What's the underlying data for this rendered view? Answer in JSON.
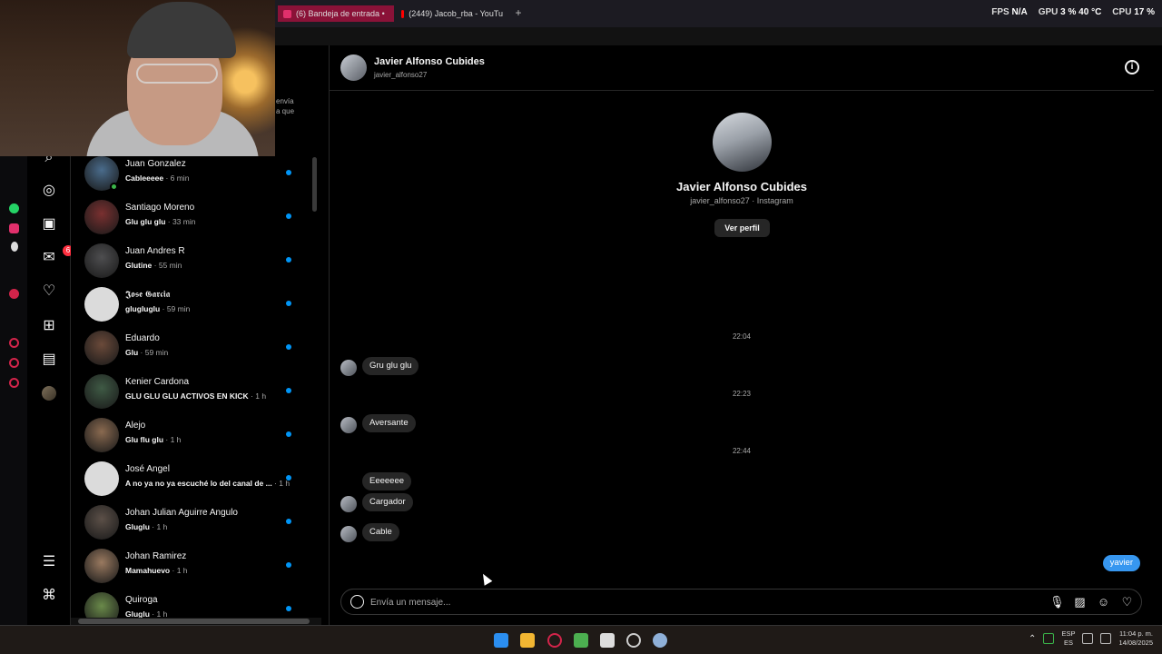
{
  "browser": {
    "tabs": [
      {
        "label": "(6) Bandeja de entrada •",
        "color": "#d2244a"
      },
      {
        "label": "(2449) Jacob_rba - YouTu",
        "color": "#ff0000"
      }
    ],
    "address_fragment": "392",
    "stats": {
      "fps_label": "FPS",
      "fps_value": "N/A",
      "gpu_label": "GPU",
      "gpu_value": "3 %",
      "gpu_temp": "40 °C",
      "cpu_label": "CPU",
      "cpu_value": "17 %"
    }
  },
  "rail": {
    "notification_badge": "6"
  },
  "list": {
    "top_snippet": [
      "envía",
      "a que"
    ],
    "conversations": [
      {
        "name": "Juan Gonzalez",
        "message": "Cableeeee",
        "time": "· 6 min",
        "online": true,
        "color": "#4a6c8c"
      },
      {
        "name": "Santiago Moreno",
        "message": "Glu glu glu",
        "time": "· 33 min",
        "online": false,
        "color": "#7a3030"
      },
      {
        "name": "Juan Andres R",
        "message": "Glutine",
        "time": "· 55 min",
        "online": false,
        "color": "#4e4e50"
      },
      {
        "name": "𝕵𝖔𝖘𝖊 𝕲𝖆𝖗𝖈𝖎𝖆",
        "message": "glugluglu",
        "time": "· 59 min",
        "online": false,
        "color": "#dbdbdb"
      },
      {
        "name": "Eduardo",
        "message": "Glu",
        "time": "· 59 min",
        "online": false,
        "color": "#6b4a3a"
      },
      {
        "name": "Kenier Cardona",
        "message": "GLU GLU GLU ACTIVOS EN KICK",
        "time": "· 1 h",
        "online": false,
        "color": "#3f5a45"
      },
      {
        "name": "Alejo",
        "message": "Glu flu glu",
        "time": "· 1 h",
        "online": false,
        "color": "#8a6a50"
      },
      {
        "name": "José Angel",
        "message": "A no ya no ya escuché lo del canal de ...",
        "time": "· 1 h",
        "online": false,
        "color": "#dbdbdb"
      },
      {
        "name": "Johan Julian Aguirre Angulo",
        "message": "Gluglu",
        "time": "· 1 h",
        "online": false,
        "color": "#5c5048"
      },
      {
        "name": "Johan Ramirez",
        "message": "Mamahuevo",
        "time": "· 1 h",
        "online": false,
        "color": "#9a7a60"
      },
      {
        "name": "Quiroga",
        "message": "Gluglu",
        "time": "· 1 h",
        "online": false,
        "color": "#6a8a4a"
      }
    ]
  },
  "chat": {
    "header_name": "Javier Alfonso Cubides",
    "header_username": "javier_alfonso27",
    "profile_name": "Javier Alfonso Cubides",
    "profile_sub": "javier_alfonso27 · Instagram",
    "view_profile_label": "Ver perfil",
    "timestamps": [
      "22:04",
      "22:23",
      "22:44"
    ],
    "messages": [
      "Gru glu glu",
      "Aversante",
      "Eeeeeee",
      "Cargador",
      "Cable"
    ],
    "my_message": "yavier",
    "composer_placeholder": "Envía un mensaje..."
  },
  "taskbar": {
    "lang_top": "ESP",
    "lang_bottom": "ES",
    "time": "11:04 p. m.",
    "date": "14/08/2025"
  }
}
